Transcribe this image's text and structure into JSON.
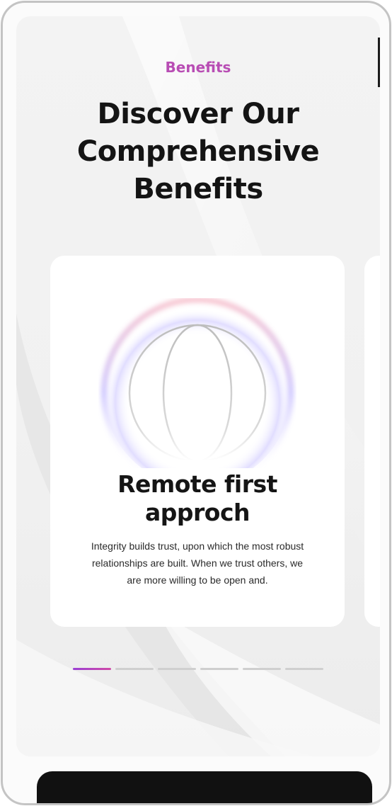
{
  "section": {
    "eyebrow": "Benefits",
    "headline": "Discover Our Comprehensive Benefits"
  },
  "carousel": {
    "active_index": 0,
    "total_slides": 6,
    "cards": [
      {
        "icon": "globe-icon",
        "title": "Remote first approch",
        "text": "Integrity builds trust, upon which the most robust relationships are built. When we trust others, we are more willing to be open and."
      }
    ]
  },
  "colors": {
    "accent": "#b84db4",
    "progress_gradient": [
      "#9b3fd4",
      "#d04aa7"
    ],
    "heading": "#141414",
    "cta_background": "#111111"
  }
}
